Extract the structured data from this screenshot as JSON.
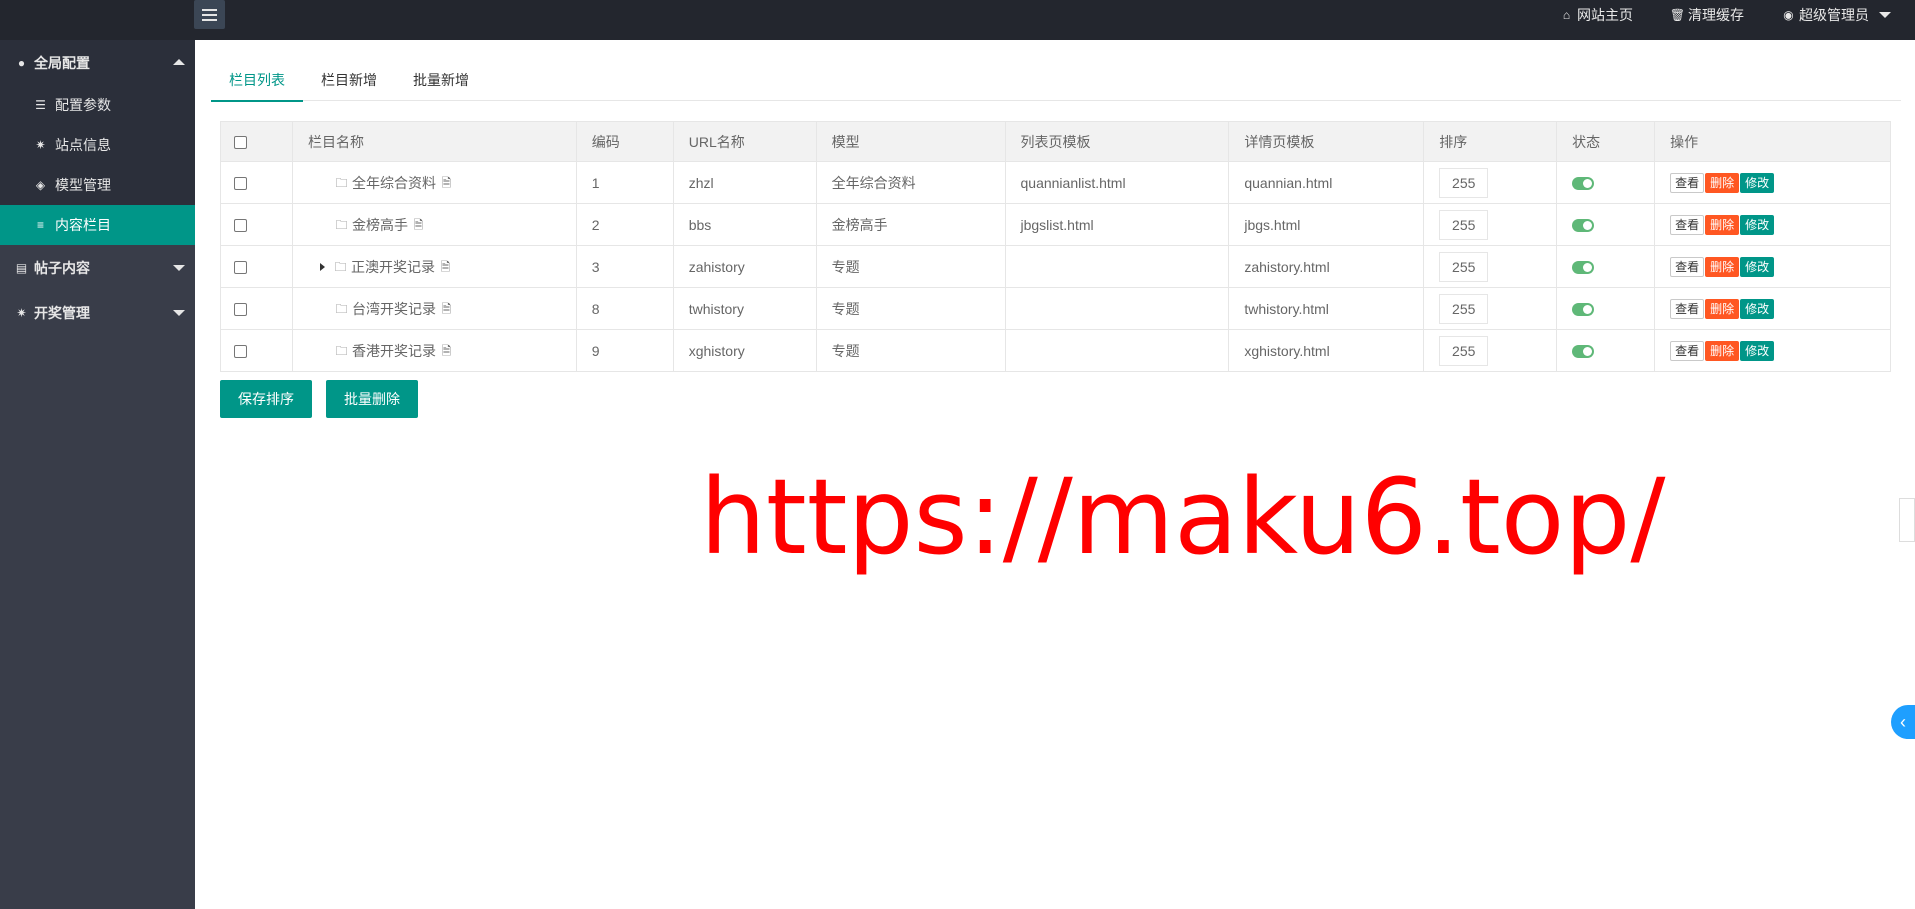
{
  "header": {
    "links": [
      {
        "icon": "home-icon",
        "label": "网站主页"
      },
      {
        "icon": "trash-icon",
        "label": "清理缓存"
      },
      {
        "icon": "user-icon",
        "label": "超级管理员"
      }
    ]
  },
  "sidebar": {
    "groups": [
      {
        "label": "全局配置",
        "icon": "globe-icon",
        "state": "open",
        "items": [
          {
            "label": "配置参数",
            "icon": "sliders-icon"
          },
          {
            "label": "站点信息",
            "icon": "gear-icon"
          },
          {
            "label": "模型管理",
            "icon": "cube-icon"
          },
          {
            "label": "内容栏目",
            "icon": "list-icon",
            "active": true
          }
        ]
      },
      {
        "label": "帖子内容",
        "icon": "file-icon",
        "state": "closed"
      },
      {
        "label": "开奖管理",
        "icon": "gear-icon",
        "state": "closed"
      }
    ]
  },
  "tabs": [
    {
      "label": "栏目列表",
      "active": true
    },
    {
      "label": "栏目新增"
    },
    {
      "label": "批量新增"
    }
  ],
  "table": {
    "columns": [
      "栏目名称",
      "编码",
      "URL名称",
      "模型",
      "列表页模板",
      "详情页模板",
      "排序",
      "状态",
      "操作"
    ],
    "rows": [
      {
        "name": "全年综合资料",
        "code": "1",
        "url": "zhzl",
        "model": "全年综合资料",
        "list_tpl": "quannianlist.html",
        "detail_tpl": "quannian.html",
        "sort": "255",
        "expandable": false
      },
      {
        "name": "金榜高手",
        "code": "2",
        "url": "bbs",
        "model": "金榜高手",
        "list_tpl": "jbgslist.html",
        "detail_tpl": "jbgs.html",
        "sort": "255",
        "expandable": false
      },
      {
        "name": "正澳开奖记录",
        "code": "3",
        "url": "zahistory",
        "model": "专题",
        "list_tpl": "",
        "detail_tpl": "zahistory.html",
        "sort": "255",
        "expandable": true
      },
      {
        "name": "台湾开奖记录",
        "code": "8",
        "url": "twhistory",
        "model": "专题",
        "list_tpl": "",
        "detail_tpl": "twhistory.html",
        "sort": "255",
        "expandable": false
      },
      {
        "name": "香港开奖记录",
        "code": "9",
        "url": "xghistory",
        "model": "专题",
        "list_tpl": "",
        "detail_tpl": "xghistory.html",
        "sort": "255",
        "expandable": false
      }
    ],
    "row_actions": {
      "view": "查看",
      "delete": "删除",
      "edit": "修改"
    }
  },
  "buttons": {
    "save_sort": "保存排序",
    "batch_delete": "批量删除"
  },
  "watermark": "https://maku6.top/",
  "colors": {
    "primary": "#009688",
    "danger": "#ff5722",
    "switch_on": "#5fb878",
    "sidebar": "#393d49",
    "header": "#23262e"
  }
}
